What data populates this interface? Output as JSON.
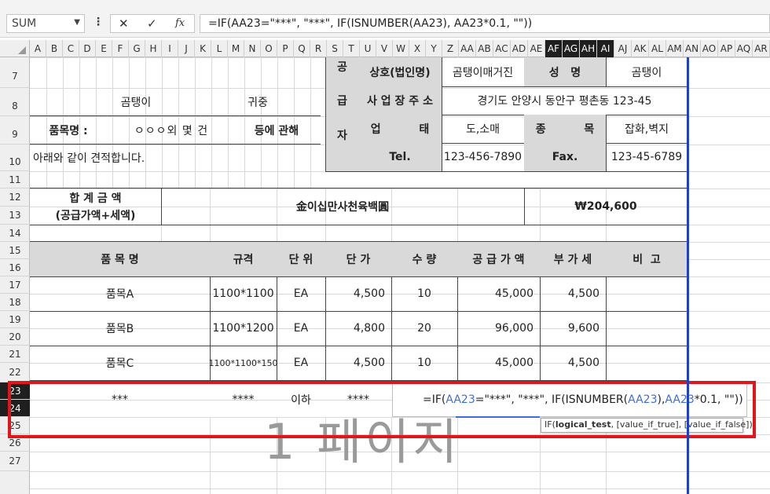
{
  "name_box": {
    "value": "SUM"
  },
  "formula_bar": {
    "cancel_icon": "✕",
    "enter_icon": "✓",
    "fx_label": "fx",
    "formula": "=IF(AA23=\"***\", \"***\", IF(ISNUMBER(AA23), AA23*0.1, \"\"))"
  },
  "columns": [
    "A",
    "B",
    "C",
    "D",
    "E",
    "F",
    "G",
    "H",
    "I",
    "J",
    "K",
    "L",
    "M",
    "N",
    "O",
    "P",
    "Q",
    "R",
    "S",
    "T",
    "U",
    "V",
    "W",
    "X",
    "Y",
    "Z",
    "AA",
    "AB",
    "AC",
    "AD",
    "AE",
    "AF",
    "AG",
    "AH",
    "AI",
    "AJ",
    "AK",
    "AL",
    "AM",
    "AN",
    "AO",
    "AP",
    "AQ",
    "AR",
    "AS"
  ],
  "selected_columns": [
    "AF",
    "AG",
    "AH",
    "AI"
  ],
  "rows": [
    "7",
    "8",
    "9",
    "10",
    "11",
    "12",
    "13",
    "14",
    "15",
    "16",
    "17",
    "18",
    "19",
    "20",
    "21",
    "22",
    "23",
    "24",
    "25",
    "26",
    "27"
  ],
  "selected_rows": [
    "23",
    "24"
  ],
  "header": {
    "recipient": "곰탱이",
    "honorific": "귀중",
    "item_label": "품목명 :",
    "item_value": "ㅇㅇㅇ외 몇 건",
    "regarding": "등에 관해",
    "intro": "아래와 같이 견적합니다.",
    "supplier_chars": [
      "공",
      "급",
      "자"
    ],
    "company_label": "상호(법인명)",
    "company_value": "곰탱이매거진",
    "ceo_label": "성   명",
    "ceo_value": "곰탱이",
    "address_label": "사 업 장 주 소",
    "address_value": "경기도 안양시 동안구 평촌동 123-45",
    "business_label": "업          태",
    "business_value": "도,소매",
    "type_label": "종          목",
    "type_value": "잡화,벽지",
    "tel_label": "Tel.",
    "tel_value": "123-456-7890",
    "fax_label": "Fax.",
    "fax_value": "123-45-6789"
  },
  "total": {
    "label_line1": "합 계 금 액",
    "label_line2": "(공급가액+세액)",
    "hangul_amount": "金이십만사천육백圓",
    "amount": "₩204,600"
  },
  "table": {
    "headers": [
      "품 목 명",
      "규격",
      "단 위",
      "단 가",
      "수 량",
      "공 급 가 액",
      "부 가 세",
      "비  고"
    ],
    "rows": [
      {
        "name": "품목A",
        "spec": "1100*1100",
        "unit": "EA",
        "price": "4,500",
        "qty": "10",
        "supply": "45,000",
        "vat": "4,500",
        "note": ""
      },
      {
        "name": "품목B",
        "spec": "1100*1200",
        "unit": "EA",
        "price": "4,800",
        "qty": "20",
        "supply": "96,000",
        "vat": "9,600",
        "note": ""
      },
      {
        "name": "품목C",
        "spec": "1100*1100*150",
        "unit": "EA",
        "price": "4,500",
        "qty": "10",
        "supply": "45,000",
        "vat": "4,500",
        "note": ""
      }
    ],
    "edit_row": {
      "name": "***",
      "spec": "****",
      "unit": "이하",
      "price": "****"
    }
  },
  "editing": {
    "p1": "=IF(",
    "ref1": "AA23",
    "p2": "=\"***\", \"***\", IF(ISNUMBER(",
    "ref2": "AA23",
    "p3": "), ",
    "ref3": "AA23",
    "p4": "*0.1, \"\"))"
  },
  "tooltip": {
    "fn": "IF(",
    "arg1": "logical_test",
    "rest": ", [value_if_true], [value_if_false])"
  },
  "page_watermark": "1 페이지"
}
